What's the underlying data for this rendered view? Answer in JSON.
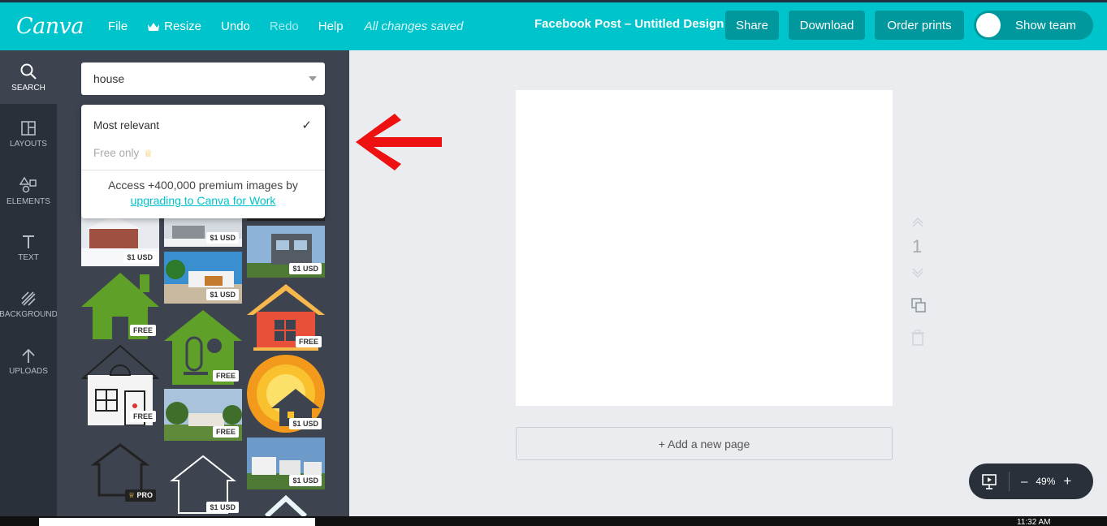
{
  "app": {
    "logo": "Canva"
  },
  "menu": {
    "file": "File",
    "resize": "Resize",
    "undo": "Undo",
    "redo": "Redo",
    "help": "Help",
    "saved_status": "All changes saved"
  },
  "design_title": "Facebook Post – Untitled Design",
  "actions": {
    "share": "Share",
    "download": "Download",
    "order_prints": "Order prints",
    "show_team": "Show team"
  },
  "rail": {
    "search": "SEARCH",
    "layouts": "LAYOUTS",
    "elements": "ELEMENTS",
    "text": "TEXT",
    "background": "BACKGROUND",
    "uploads": "UPLOADS"
  },
  "search": {
    "value": "house"
  },
  "dropdown": {
    "option_1": "Most relevant",
    "option_2": "Free only",
    "promo_text": "Access +400,000 premium images by",
    "promo_link": "upgrading to Canva for Work"
  },
  "badges": {
    "paid": "$1 USD",
    "free": "FREE",
    "pro": "PRO"
  },
  "canvas": {
    "page_number": "1",
    "add_page": "+ Add a new page"
  },
  "zoom": {
    "level": "49%",
    "minus": "–",
    "plus": "+"
  },
  "taskbar": {
    "time": "11:32 AM"
  },
  "colors": {
    "brand": "#00c4cc",
    "brand_dark": "#00979d",
    "rail": "#293039",
    "panel": "#3d4450",
    "arrow": "#ee1111"
  }
}
